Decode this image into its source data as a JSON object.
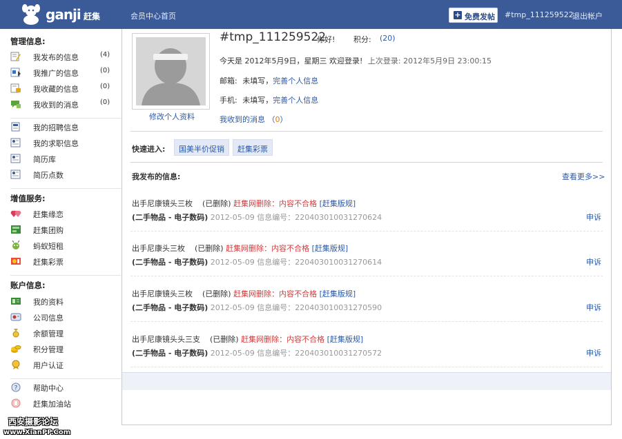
{
  "header": {
    "logo_text": "ganji",
    "logo_cn": "赶集",
    "home_link": "会员中心首页",
    "post_button": "免费发帖",
    "username": "#tmp_111259522",
    "logout": "退出帐户"
  },
  "sidebar": {
    "sections": [
      {
        "title": "管理信息:",
        "items": [
          {
            "label": "我发布的信息",
            "count": "(4)",
            "icon": "edit-icon"
          },
          {
            "label": "我推广的信息",
            "count": "(0)",
            "icon": "promote-icon"
          },
          {
            "label": "我收藏的信息",
            "count": "(0)",
            "icon": "favorite-icon"
          },
          {
            "label": "我收到的消息",
            "count": "(0)",
            "icon": "message-icon"
          }
        ]
      },
      {
        "title": "",
        "items": [
          {
            "label": "我的招聘信息",
            "count": "",
            "icon": "recruit-icon"
          },
          {
            "label": "我的求职信息",
            "count": "",
            "icon": "resume-icon"
          },
          {
            "label": "简历库",
            "count": "",
            "icon": "resume-library-icon"
          },
          {
            "label": "简历点数",
            "count": "",
            "icon": "resume-points-icon"
          }
        ]
      },
      {
        "title": "增值服务:",
        "items": [
          {
            "label": "赶集缘恋",
            "count": "",
            "icon": "hearts-icon"
          },
          {
            "label": "赶集团购",
            "count": "",
            "icon": "groupbuy-icon"
          },
          {
            "label": "蚂蚁短租",
            "count": "",
            "icon": "ant-icon"
          },
          {
            "label": "赶集彩票",
            "count": "",
            "icon": "lottery-icon"
          }
        ]
      },
      {
        "title": "账户信息:",
        "items": [
          {
            "label": "我的资料",
            "count": "",
            "icon": "profile-card-icon"
          },
          {
            "label": "公司信息",
            "count": "",
            "icon": "company-icon"
          },
          {
            "label": "余额管理",
            "count": "",
            "icon": "balance-icon"
          },
          {
            "label": "积分管理",
            "count": "",
            "icon": "coins-icon"
          },
          {
            "label": "用户认证",
            "count": "",
            "icon": "verify-icon"
          }
        ]
      },
      {
        "title": "",
        "items": [
          {
            "label": "帮助中心",
            "count": "",
            "icon": "help-icon"
          },
          {
            "label": "赶集加油站",
            "count": "",
            "icon": "gas-station-icon"
          }
        ]
      }
    ],
    "watermark_line1": "西安摄影论坛",
    "watermark_line2": "www.XianPP.Com"
  },
  "profile": {
    "edit_link": "修改个人资料",
    "username": "#tmp_111259522",
    "hello": "你好!",
    "points_label": "积分:",
    "points_value": "(20)",
    "today": "今天是 2012年5月9日，星期三 欢迎登录!",
    "last_login_label": "上次登录:",
    "last_login_value": "2012年5月9日 23:00:15",
    "email_label": "邮箱:",
    "email_value": "未填写，",
    "email_link": "完善个人信息",
    "phone_label": "手机:",
    "phone_value": "未填写，",
    "phone_link": "完善个人信息",
    "messages_label": "我收到的消息",
    "messages_count": "0"
  },
  "quick_entry": {
    "label": "快速进入:",
    "buttons": [
      "国美半价促销",
      "赶集彩票"
    ]
  },
  "posted": {
    "title": "我发布的信息:",
    "more": "查看更多>>",
    "items": [
      {
        "title": "出手尼康镜头三枚",
        "status": "(已删除)",
        "reason": "赶集网删除：内容不合格",
        "rule": "[赶集版规]",
        "category": "(二手物品 - 电子数码)",
        "meta": "2012-05-09 信息编号：220403010031270624",
        "appeal": "申诉"
      },
      {
        "title": "出手尼康头三枚",
        "status": "(已删除)",
        "reason": "赶集网删除：内容不合格",
        "rule": "[赶集版规]",
        "category": "(二手物品 - 电子数码)",
        "meta": "2012-05-09 信息编号：220403010031270614",
        "appeal": "申诉"
      },
      {
        "title": "出手尼康镜头三枚",
        "status": "(已删除)",
        "reason": "赶集网删除：内容不合格",
        "rule": "[赶集版规]",
        "category": "(二手物品 - 电子数码)",
        "meta": "2012-05-09 信息编号：220403010031270590",
        "appeal": "申诉"
      },
      {
        "title": "出手尼康镜头头三支",
        "status": "(已删除)",
        "reason": "赶集网删除：内容不合格",
        "rule": "[赶集版规]",
        "category": "(二手物品 - 电子数码)",
        "meta": "2012-05-09 信息编号：220403010031270572",
        "appeal": "申诉"
      }
    ]
  }
}
